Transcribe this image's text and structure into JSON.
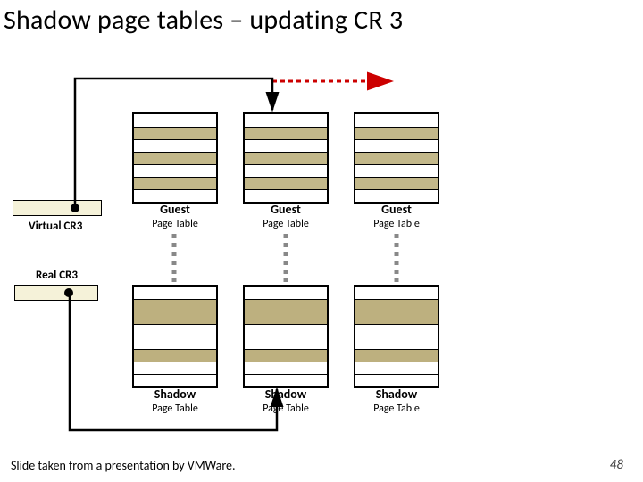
{
  "title": "Shadow page tables – updating CR 3",
  "footer": {
    "attribution": "Slide taken from a presentation by VMWare.",
    "page_number": "48"
  },
  "registers": {
    "virtual": {
      "label": "Virtual CR3"
    },
    "real": {
      "label": "Real CR3"
    }
  },
  "guest_tables": {
    "caption_strong": "Guest",
    "caption_sub": "Page Table"
  },
  "shadow_tables": {
    "caption_strong": "Shadow",
    "caption_sub": "Page Table"
  },
  "colors": {
    "fill": "#c3b88a",
    "reg_bg": "#f5f2d9",
    "arrow_red": "#cc0000"
  }
}
